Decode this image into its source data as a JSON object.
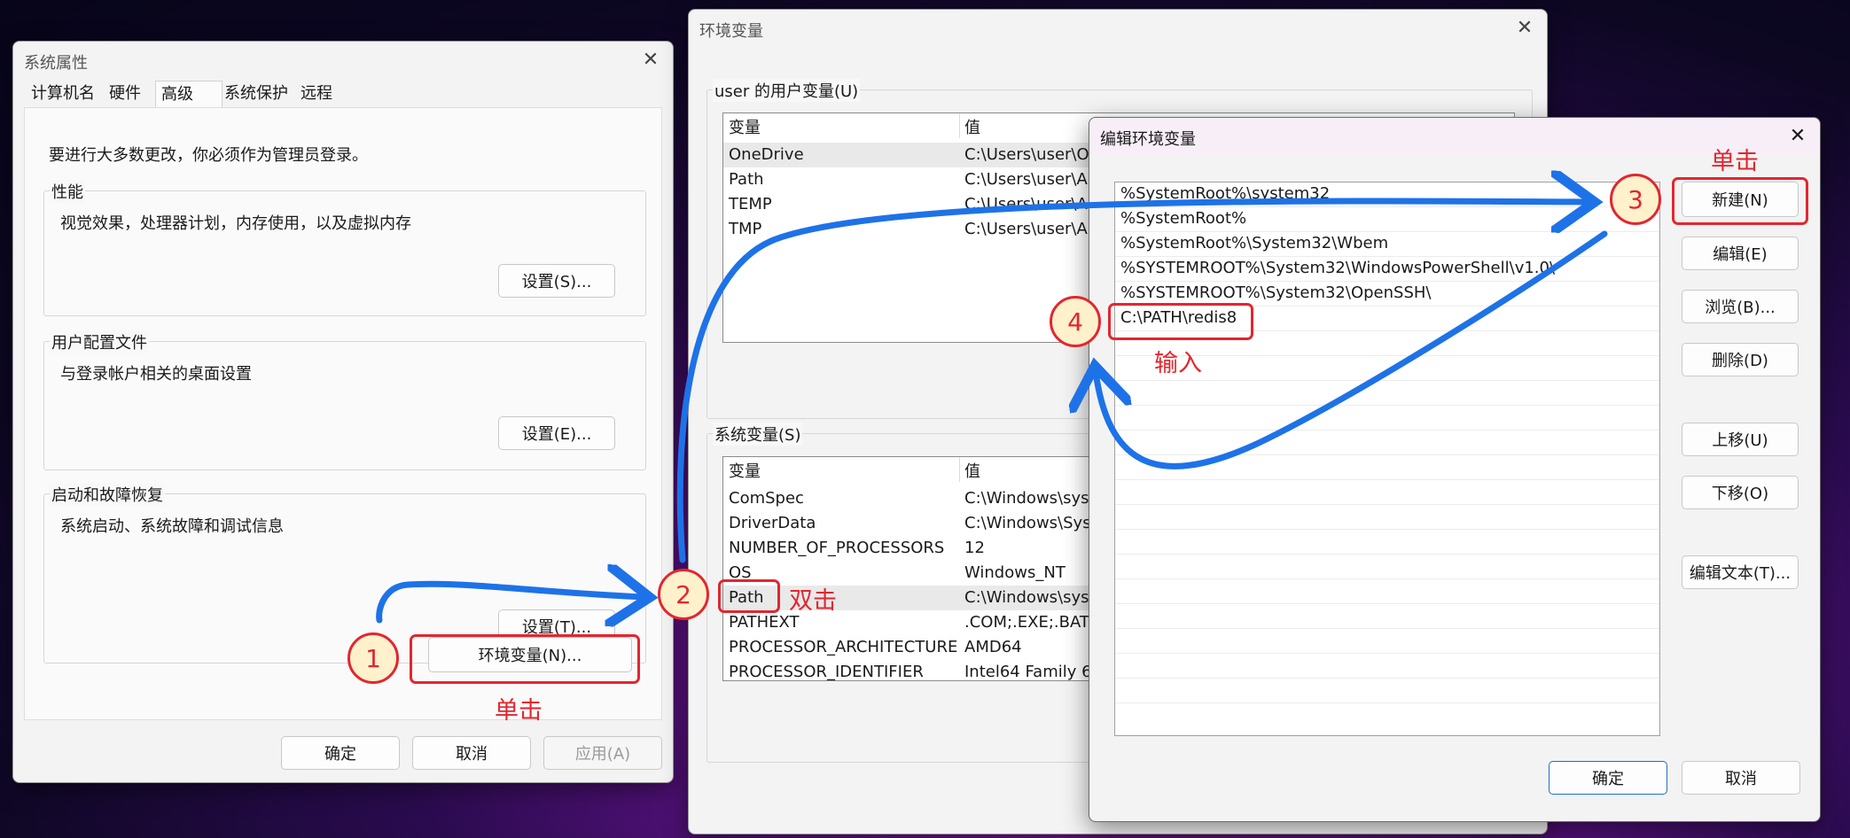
{
  "sysprops": {
    "title": "系统属性",
    "close": "✕",
    "tabs": [
      "计算机名",
      "硬件",
      "高级",
      "系统保护",
      "远程"
    ],
    "admin_note": "要进行大多数更改，你必须作为管理员登录。",
    "perf": {
      "label": "性能",
      "desc": "视觉效果，处理器计划，内存使用，以及虚拟内存",
      "button": "设置(S)..."
    },
    "profile": {
      "label": "用户配置文件",
      "desc": "与登录帐户相关的桌面设置",
      "button": "设置(E)..."
    },
    "startup": {
      "label": "启动和故障恢复",
      "desc": "系统启动、系统故障和调试信息",
      "button": "设置(T)..."
    },
    "env_button": "环境变量(N)...",
    "ok": "确定",
    "cancel": "取消",
    "apply": "应用(A)"
  },
  "envvars": {
    "title": "环境变量",
    "close": "✕",
    "user_group": "user 的用户变量(U)",
    "col_var": "变量",
    "col_val": "值",
    "user_rows": [
      {
        "name": "OneDrive",
        "value": "C:\\Users\\user\\On"
      },
      {
        "name": "Path",
        "value": "C:\\Users\\user\\Ap"
      },
      {
        "name": "TEMP",
        "value": "C:\\Users\\user\\Ap"
      },
      {
        "name": "TMP",
        "value": "C:\\Users\\user\\Ap"
      }
    ],
    "sys_group": "系统变量(S)",
    "sys_rows": [
      {
        "name": "ComSpec",
        "value": "C:\\Windows\\syst"
      },
      {
        "name": "DriverData",
        "value": "C:\\Windows\\Syst"
      },
      {
        "name": "NUMBER_OF_PROCESSORS",
        "value": "12"
      },
      {
        "name": "OS",
        "value": "Windows_NT"
      },
      {
        "name": "Path",
        "value": "C:\\Windows\\syst"
      },
      {
        "name": "PATHEXT",
        "value": ".COM;.EXE;.BAT;."
      },
      {
        "name": "PROCESSOR_ARCHITECTURE",
        "value": "AMD64"
      },
      {
        "name": "PROCESSOR_IDENTIFIER",
        "value": "Intel64 Family 6"
      }
    ]
  },
  "editenv": {
    "title": "编辑环境变量",
    "close": "✕",
    "entries": [
      "%SystemRoot%\\system32",
      "%SystemRoot%",
      "%SystemRoot%\\System32\\Wbem",
      "%SYSTEMROOT%\\System32\\WindowsPowerShell\\v1.0\\",
      "%SYSTEMROOT%\\System32\\OpenSSH\\",
      "C:\\PATH\\redis8"
    ],
    "buttons": {
      "new": "新建(N)",
      "edit": "编辑(E)",
      "browse": "浏览(B)...",
      "delete": "删除(D)",
      "up": "上移(U)",
      "down": "下移(O)",
      "edit_text": "编辑文本(T)..."
    },
    "ok": "确定",
    "cancel": "取消"
  },
  "annotations": {
    "step1": "1",
    "step2": "2",
    "step3": "3",
    "step4": "4",
    "click": "单击",
    "double_click": "双击",
    "input": "输入",
    "red": "#e3262f",
    "arrow_blue": "#1e72e8"
  }
}
